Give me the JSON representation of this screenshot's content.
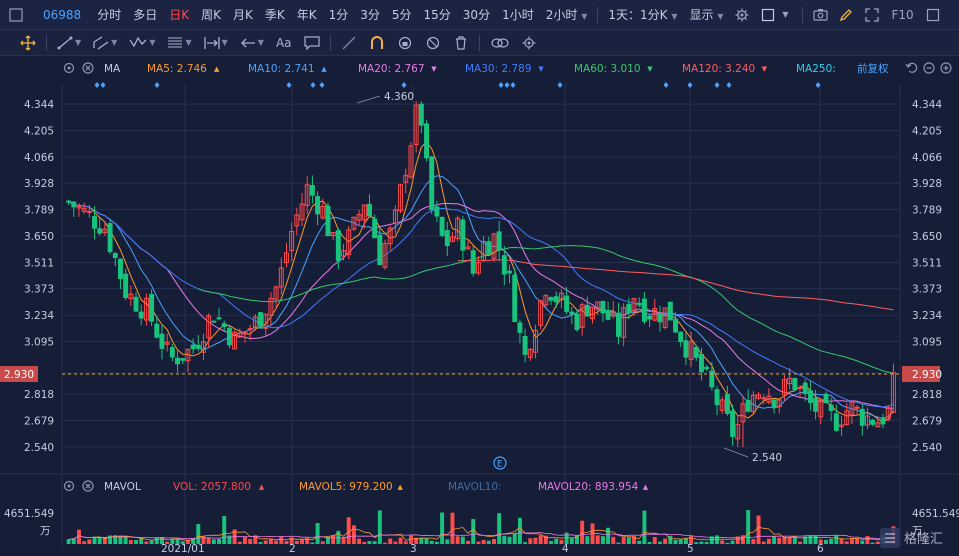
{
  "top_bar": {
    "code": "06988",
    "tabs": [
      "分时",
      "多日",
      "日K",
      "周K",
      "月K",
      "季K",
      "年K",
      "1分",
      "3分",
      "5分",
      "15分",
      "30分",
      "1小时",
      "2小时"
    ],
    "active_tab": "日K",
    "period_select": "1天：1分K",
    "display_label": "显示",
    "f10_label": "F10"
  },
  "toolbar": {
    "text_tool_label": "Aa"
  },
  "ma_legend": {
    "title": "MA",
    "items": [
      {
        "label": "MA5: 2.746",
        "color": "#ff9a2e",
        "arrow": "▲"
      },
      {
        "label": "MA10: 2.741",
        "color": "#4aa3ff",
        "arrow": "▲"
      },
      {
        "label": "MA20: 2.767",
        "color": "#e77be6",
        "arrow": "▼"
      },
      {
        "label": "MA30: 2.789",
        "color": "#3f7dff",
        "arrow": "▼"
      },
      {
        "label": "MA60: 3.010",
        "color": "#35c96b",
        "arrow": "▼"
      },
      {
        "label": "MA120: 3.240",
        "color": "#ff5f5f",
        "arrow": "▼"
      },
      {
        "label": "MA250:",
        "color": "#2fd0f0",
        "arrow": ""
      }
    ],
    "adjust_label": "前复权"
  },
  "vol_legend": {
    "title": "MAVOL",
    "items": [
      {
        "label": "VOL: 2057.800",
        "color": "#ff4b4b",
        "arrow": "▲"
      },
      {
        "label": "MAVOL5: 979.200",
        "color": "#ff9a2e",
        "arrow": "▲"
      },
      {
        "label": "MAVOL10:",
        "color": "#3f6da8",
        "arrow": ""
      },
      {
        "label": "MAVOL20: 893.954",
        "color": "#e77be6",
        "arrow": "▲"
      }
    ]
  },
  "colors": {
    "up": "#ff4b4b",
    "down": "#19c37d",
    "background": "#151d37",
    "grid": "#26304f",
    "current_price_line": "#e8a33c"
  },
  "chart_data": {
    "type": "candlestick",
    "y_ticks": [
      "4.344",
      "4.205",
      "4.066",
      "3.928",
      "3.789",
      "3.650",
      "3.511",
      "3.373",
      "3.234",
      "3.095",
      "2.930",
      "2.818",
      "2.679",
      "2.540"
    ],
    "ylim": [
      2.44,
      4.45
    ],
    "current_price": "2.930",
    "x_labels": [
      "2021/01",
      "2",
      "3",
      "4",
      "5",
      "6"
    ],
    "annotations": [
      {
        "text": "4.360",
        "value": 4.36
      },
      {
        "text": "2.540",
        "value": 2.54
      }
    ],
    "candle_count": 160,
    "volume_axis_label": "4651.549",
    "volume_unit": "万",
    "volume_max": 4651.549
  },
  "watermark": "格隆汇"
}
